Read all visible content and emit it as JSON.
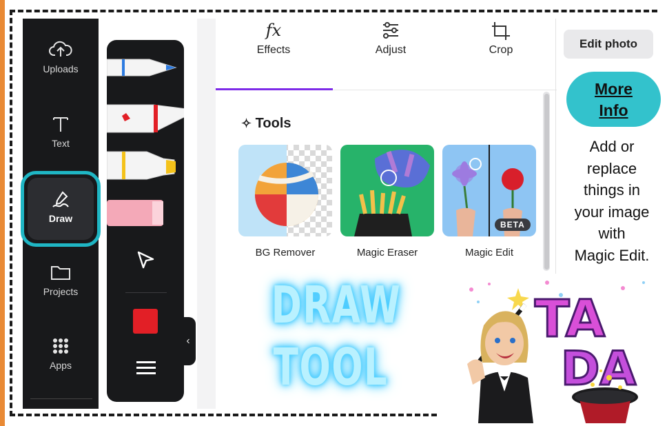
{
  "sidebar": {
    "items": [
      {
        "label": "Uploads",
        "icon": "cloud-upload-icon"
      },
      {
        "label": "Text",
        "icon": "text-icon"
      },
      {
        "label": "Draw",
        "icon": "draw-icon",
        "active": true
      },
      {
        "label": "Projects",
        "icon": "folder-icon"
      },
      {
        "label": "Apps",
        "icon": "grid-icon"
      }
    ]
  },
  "draw_toolbar": {
    "tools": [
      "pen",
      "marker",
      "highlighter",
      "eraser",
      "select-arrow"
    ],
    "current_color": "#e21f26",
    "colors": {
      "pen": "#2d7be0",
      "marker": "#e21f26",
      "highlighter": "#f4c21a",
      "eraser": "#f4a9b8"
    }
  },
  "tabs": [
    {
      "label": "Effects",
      "glyph": "fx",
      "active": true
    },
    {
      "label": "Adjust",
      "glyph": "sliders"
    },
    {
      "label": "Crop",
      "glyph": "crop"
    }
  ],
  "tools_section": {
    "title": "Tools",
    "cards": [
      {
        "label": "BG Remover"
      },
      {
        "label": "Magic Eraser"
      },
      {
        "label": "Magic Edit",
        "badge": "BETA"
      }
    ]
  },
  "right_panel": {
    "edit_button": "Edit photo",
    "more_info_line1": "More",
    "more_info_line2": "Info",
    "description_lines": [
      "Add or",
      "replace",
      "things in",
      "your image",
      "with",
      "Magic Edit."
    ]
  },
  "overlay": {
    "line1": "DRAW",
    "line2": "TOOL",
    "sticker_text_1": "TA",
    "sticker_text_2": "DA"
  },
  "colors": {
    "accent": "#7d2ae8",
    "highlight": "#1fb6c4",
    "more_info": "#33c2cc"
  }
}
